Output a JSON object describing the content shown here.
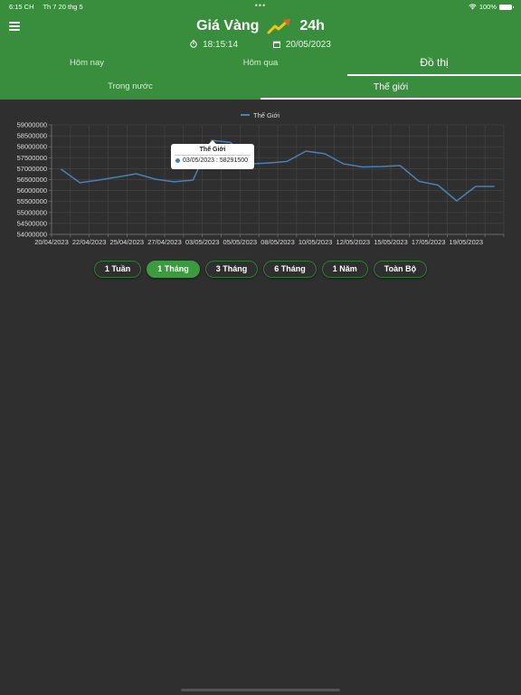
{
  "status_bar": {
    "time": "6:15 CH",
    "date": "Th 7 20 thg 5",
    "dots": "•••",
    "battery": "100%"
  },
  "header": {
    "title_left": "Giá Vàng",
    "title_right": "24h",
    "clock": "18:15:14",
    "date": "20/05/2023",
    "icons": {
      "menu": "menu-icon",
      "logo": "trending-up-icon",
      "clock": "timer-icon",
      "date": "calendar-icon"
    }
  },
  "tabs": [
    {
      "label": "Hôm nay",
      "active": false
    },
    {
      "label": "Hôm qua",
      "active": false
    },
    {
      "label": "Đồ thị",
      "active": true
    }
  ],
  "subtabs": [
    {
      "label": "Trong nước",
      "active": false
    },
    {
      "label": "Thế giới",
      "active": true
    }
  ],
  "colors": {
    "primary": "#388e3c",
    "accent_button": "#3c9a40",
    "line": "#4682b4",
    "background": "#2f2f2f"
  },
  "tooltip": {
    "title": "Thế Giới",
    "label": "03/05/2023 : 58291500"
  },
  "ranges": [
    {
      "label": "1 Tuần",
      "active": false
    },
    {
      "label": "1 Tháng",
      "active": true
    },
    {
      "label": "3 Tháng",
      "active": false
    },
    {
      "label": "6 Tháng",
      "active": false
    },
    {
      "label": "1 Năm",
      "active": false
    },
    {
      "label": "Toàn Bộ",
      "active": false
    }
  ],
  "chart_data": {
    "type": "line",
    "title": "",
    "xlabel": "",
    "ylabel": "",
    "legend": {
      "entries": [
        "Thế Giới"
      ],
      "position": "top-center"
    },
    "grid": true,
    "ylim": [
      54000000,
      59000000
    ],
    "yticks": [
      54000000,
      54500000,
      55000000,
      55500000,
      56000000,
      56500000,
      57000000,
      57500000,
      58000000,
      58500000,
      59000000
    ],
    "xtick_labels": [
      "20/04/2023",
      "22/04/2023",
      "25/04/2023",
      "27/04/2023",
      "03/05/2023",
      "05/05/2023",
      "08/05/2023",
      "10/05/2023",
      "12/05/2023",
      "15/05/2023",
      "17/05/2023",
      "19/05/2023"
    ],
    "categories": [
      "20/04/2023",
      "21/04/2023",
      "22/04/2023",
      "24/04/2023",
      "25/04/2023",
      "26/04/2023",
      "27/04/2023",
      "28/04/2023",
      "03/05/2023",
      "04/05/2023",
      "05/05/2023",
      "06/05/2023",
      "08/05/2023",
      "09/05/2023",
      "10/05/2023",
      "11/05/2023",
      "12/05/2023",
      "13/05/2023",
      "15/05/2023",
      "16/05/2023",
      "17/05/2023",
      "18/05/2023",
      "19/05/2023",
      "20/05/2023"
    ],
    "series": [
      {
        "name": "Thế Giới",
        "color": "#4682b4",
        "values": [
          56980000,
          56360000,
          56480000,
          56620000,
          56770000,
          56520000,
          56400000,
          56480000,
          58291500,
          58200000,
          57220000,
          57260000,
          57330000,
          57800000,
          57680000,
          57220000,
          57080000,
          57100000,
          57140000,
          56420000,
          56250000,
          55530000,
          56190000,
          56190000
        ]
      }
    ],
    "highlight": {
      "category": "03/05/2023",
      "value": 58291500
    }
  }
}
